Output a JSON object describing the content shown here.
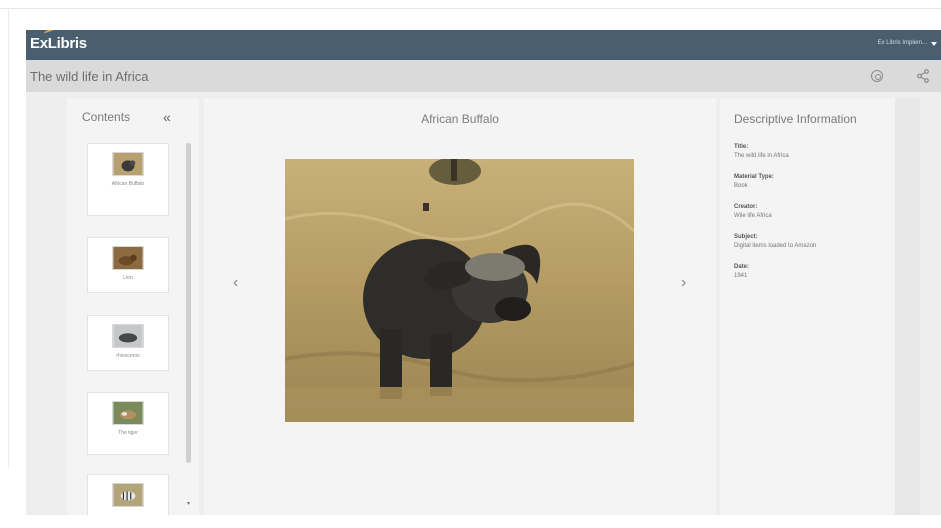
{
  "header": {
    "logo_text": "ExLibris",
    "user_menu_label": "Ex Libris Implem...",
    "brand_color": "#495f70",
    "accent_color": "#e8a33c"
  },
  "record": {
    "title": "The wild life in Africa",
    "settings_icon": "settings-icon",
    "share_icon": "share-icon"
  },
  "contents": {
    "title": "Contents",
    "collapse_icon": "«",
    "items": [
      {
        "label": "African Buffalo"
      },
      {
        "label": "Lion"
      },
      {
        "label": "rhinoceros"
      },
      {
        "label": "The tiger"
      },
      {
        "label": ""
      }
    ]
  },
  "viewer": {
    "title": "African Buffalo",
    "prev_icon": "‹",
    "next_icon": "›"
  },
  "info": {
    "title": "Descriptive Information",
    "fields": [
      {
        "label": "Title:",
        "value": "The wild life in Africa"
      },
      {
        "label": "Material Type:",
        "value": "Book"
      },
      {
        "label": "Creator:",
        "value": "Wile life Africa"
      },
      {
        "label": "Subject:",
        "value": "Digital items loaded to Amazon"
      },
      {
        "label": "Date:",
        "value": "1941"
      }
    ]
  }
}
